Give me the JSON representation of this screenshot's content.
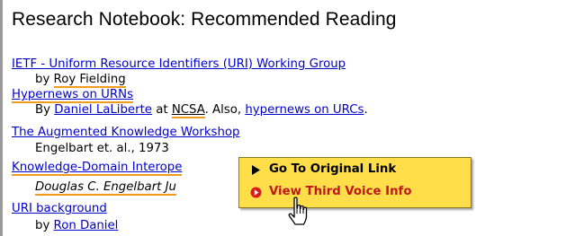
{
  "page_title": "Research Notebook: Recommended Reading",
  "entries": [
    {
      "link": "IETF - Uniform Resource Identifiers (URI) Working Group",
      "by_prefix": "by ",
      "author": "Roy Fielding"
    },
    {
      "link": "Hypernews on URNs",
      "by_prefix": "By ",
      "author": "Daniel LaLiberte",
      "at_text": " at ",
      "org": "NCSA",
      "also_text": ". Also, ",
      "also_link": "hypernews on URCs",
      "end": "."
    },
    {
      "link": "The Augmented Knowledge Workshop",
      "byline": "Engelbart et. al., 1973"
    },
    {
      "link": "Knowledge-Domain Interope",
      "byline": "Douglas C. Engelbart Ju"
    },
    {
      "link": "URI background",
      "by_prefix": "by ",
      "author": "Ron Daniel"
    }
  ],
  "context_menu": {
    "item1": "Go To Original Link",
    "item2": "View Third Voice Info"
  },
  "colors": {
    "link": "#0000cc",
    "annotation_underline": "#f29a1b",
    "menu_bg": "#ffde4a",
    "menu_item2_text": "#c01818"
  },
  "icons": [
    "triangle-right-icon",
    "red-circle-arrow-icon",
    "hand-pointer-cursor-icon"
  ]
}
